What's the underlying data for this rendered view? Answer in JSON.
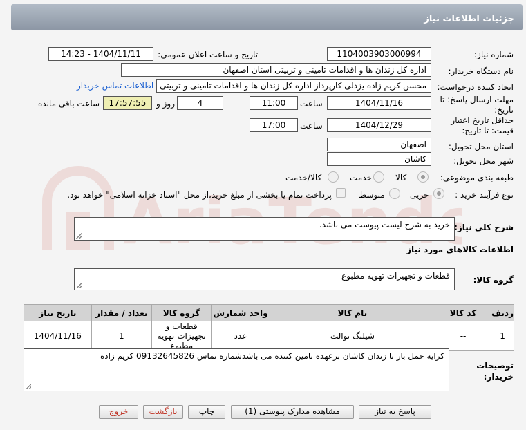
{
  "header": {
    "title": "جزئیات اطلاعات نیاز"
  },
  "form": {
    "need_number": {
      "label": "شماره نیاز:",
      "value": "1104003903000994"
    },
    "announce_datetime": {
      "label": "تاریخ و ساعت اعلان عمومی:",
      "value": "1404/11/11 - 14:23"
    },
    "buyer_org": {
      "label": "نام دستگاه خریدار:",
      "value": "اداره کل زندان ها و اقدامات تامینی و تربیتی استان اصفهان"
    },
    "requester": {
      "label": "ایجاد کننده درخواست:",
      "value": "محسن کریم زاده یزدلی کارپرداز اداره کل زندان ها و اقدامات تامینی و تربیتی اس",
      "link": "اطلاعات تماس خریدار"
    },
    "reply_deadline": {
      "label_line1": "مهلت ارسال پاسخ: تا",
      "label_line2": "تاریخ:",
      "date": "1404/11/16",
      "time_label": "ساعت",
      "time": "11:00",
      "days": "4",
      "days_label": "روز و",
      "remaining": "17:57:55",
      "remaining_label": "ساعت باقی مانده"
    },
    "price_validity": {
      "label_line1": "حداقل تاریخ اعتبار",
      "label_line2": "قیمت: تا تاریخ:",
      "date": "1404/12/29",
      "time_label": "ساعت",
      "time": "17:00"
    },
    "delivery_province": {
      "label": "استان محل تحویل:",
      "value": "اصفهان"
    },
    "delivery_city": {
      "label": "شهر محل تحویل:",
      "value": "کاشان"
    },
    "category": {
      "label": "طبقه بندی موضوعی:",
      "options": [
        "کالا",
        "خدمت",
        "کالا/خدمت"
      ],
      "selected": "کالا"
    },
    "purchase_type": {
      "label": "نوع فرآیند خرید :",
      "options": [
        "جزیی",
        "متوسط"
      ],
      "selected": "جزیی",
      "note": "پرداخت تمام یا بخشی از مبلغ خرید،از محل \"اسناد خزانه اسلامی\" خواهد بود."
    }
  },
  "general_description": {
    "label": "شرح کلی نیاز:",
    "value": "خرید به شرح لیست پیوست می باشد."
  },
  "goods_section": {
    "title": "اطلاعات کالاهای مورد نیاز"
  },
  "goods_group": {
    "label": "گروه کالا:",
    "value": "قطعات و تجهیزات تهویه مطبوع"
  },
  "table": {
    "headers": [
      "ردیف",
      "کد کالا",
      "نام کالا",
      "واحد شمارش",
      "گروه کالا",
      "تعداد / مقدار",
      "تاریخ نیاز"
    ],
    "rows": [
      [
        "1",
        "--",
        "شیلنگ توالت",
        "عدد",
        "قطعات و تجهیزات تهویه مطبوع",
        "1",
        "1404/11/16"
      ]
    ]
  },
  "buyer_notes": {
    "label_line1": "توضیحات",
    "label_line2": "خریدار:",
    "value": "کرایه حمل بار تا زندان کاشان برعهده تامین کننده می باشدشماره تماس 09132645826 کریم زاده"
  },
  "buttons": {
    "reply": "پاسخ به نیاز",
    "attachments": "مشاهده مدارک پیوستی (1)",
    "print": "چاپ",
    "back": "بازگشت",
    "exit": "خروج"
  },
  "watermark": {
    "text": "AriaTender.net"
  },
  "colors": {
    "header": "#98a2af",
    "link": "#1a5fd1",
    "remaining_bg": "#efefb3",
    "table_header": "#d3d3d3"
  }
}
